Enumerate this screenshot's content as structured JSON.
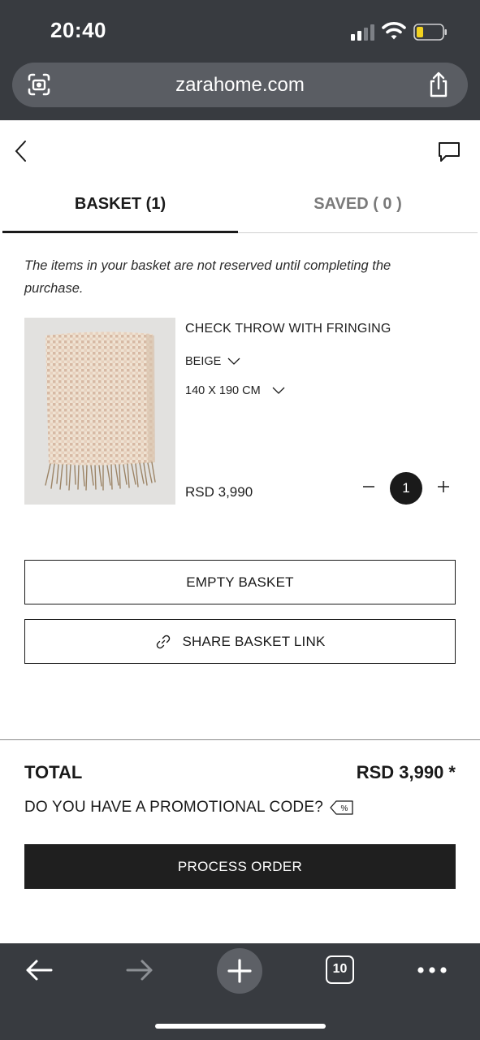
{
  "status_bar": {
    "time": "20:40"
  },
  "browser": {
    "url": "zarahome.com",
    "open_tabs": "10"
  },
  "tabs": {
    "basket": "BASKET (1)",
    "saved": "SAVED ( 0 )"
  },
  "notice": "The items in your basket are not reserved until completing the purchase.",
  "product": {
    "name": "CHECK THROW WITH FRINGING",
    "color": "BEIGE",
    "size": "140 X 190 CM",
    "price": "RSD 3,990",
    "quantity": "1"
  },
  "actions": {
    "empty_basket": "EMPTY BASKET",
    "share_basket": "SHARE BASKET LINK"
  },
  "summary": {
    "total_label": "TOTAL",
    "total_value": "RSD 3,990 *",
    "promo_question": "DO YOU HAVE A PROMOTIONAL CODE?",
    "process_order": "PROCESS ORDER"
  },
  "icons": {
    "status": [
      "signal-icon",
      "wifi-icon",
      "battery-icon"
    ],
    "browser": [
      "lens-icon",
      "share-icon",
      "back-arrow-icon",
      "forward-arrow-icon",
      "plus-icon",
      "tabs-icon",
      "more-icon"
    ],
    "page": [
      "back-chevron-icon",
      "chat-icon",
      "chevron-down-icon",
      "minus-icon",
      "plus-icon",
      "link-icon",
      "promo-tag-icon"
    ]
  },
  "colors": {
    "browser_chrome": "#383b40",
    "url_bar": "#5a5d63",
    "primary_text": "#1a1a1a",
    "muted_tab": "#7a7a7a",
    "process_button": "#1f1f1f",
    "battery_level": "#f2d21f"
  }
}
